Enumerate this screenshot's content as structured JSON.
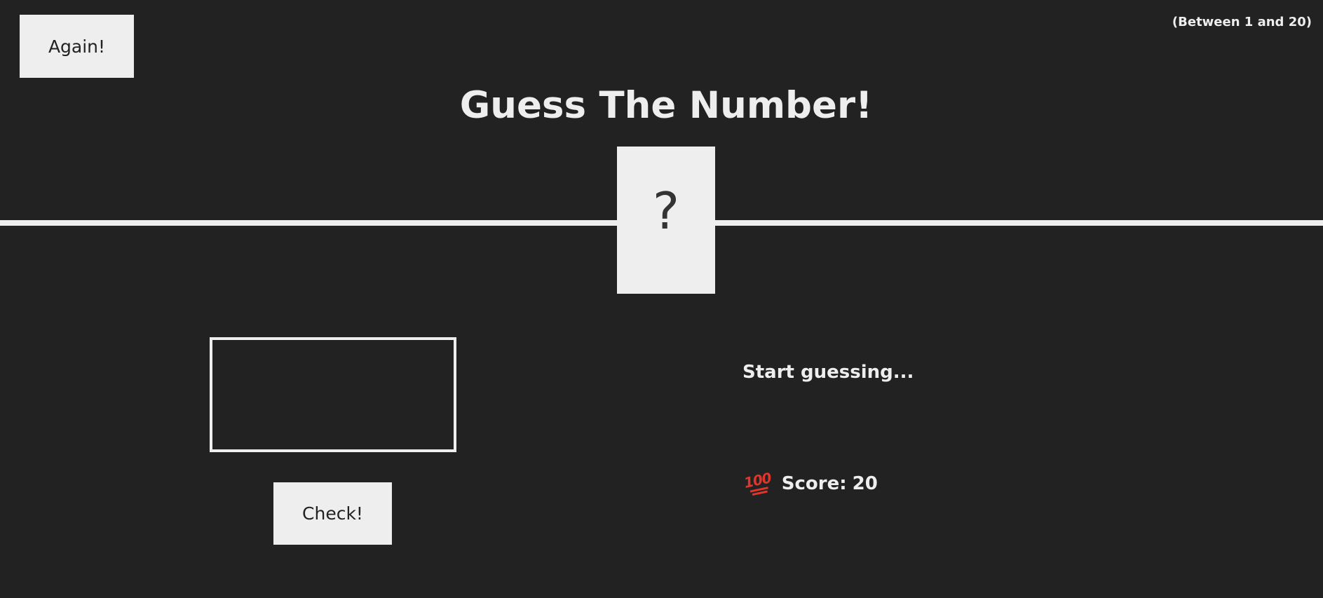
{
  "header": {
    "again_label": "Again!",
    "range_hint": "(Between 1 and 20)",
    "title": "Guess The Number!"
  },
  "secret": {
    "display": "?"
  },
  "left": {
    "guess_value": "",
    "check_label": "Check!"
  },
  "right": {
    "message": "Start guessing...",
    "score_icon": "hundred-points-icon",
    "score_label": "Score:",
    "score_value": "20"
  },
  "colors": {
    "background": "#222222",
    "foreground": "#eeeeee",
    "icon_red": "#e0352b"
  }
}
